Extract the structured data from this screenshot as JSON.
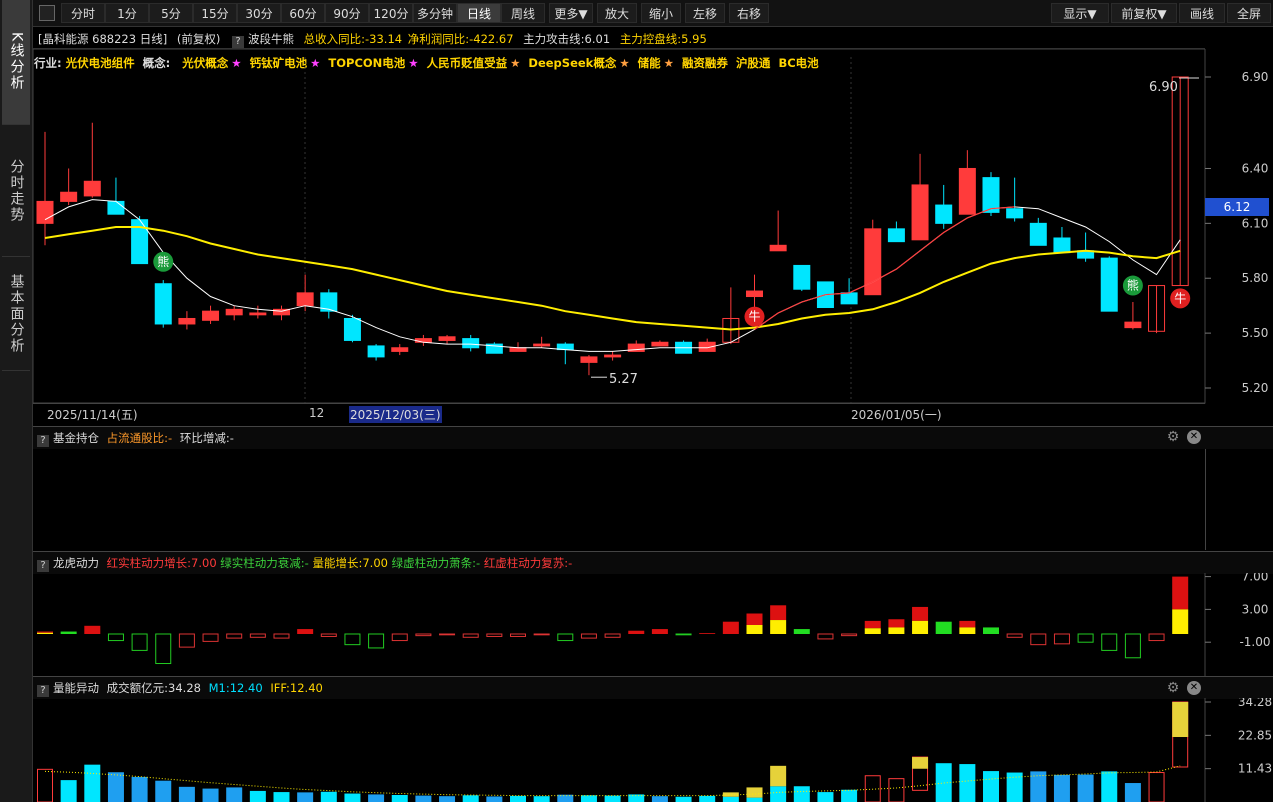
{
  "sidebar": {
    "tabs": [
      {
        "label": "K线分析",
        "active": true
      },
      {
        "label": "分时走势",
        "active": false
      },
      {
        "label": "基本面分析",
        "active": false
      }
    ]
  },
  "toolbar": {
    "periods": [
      "分时",
      "1分",
      "5分",
      "15分",
      "30分",
      "60分",
      "90分",
      "120分",
      "多分钟",
      "日线",
      "周线",
      "更多▼",
      "放大",
      "缩小",
      "左移",
      "右移"
    ],
    "active_period": "日线",
    "right_buttons": [
      "显示▼",
      "前复权▼",
      "画线",
      "全屏"
    ]
  },
  "info_bar": {
    "stock": "[晶科能源 688223 日线]",
    "adjust": "(前复权)",
    "indicator": "波段牛熊",
    "revenue": "总收入同比:-33.14",
    "profit": "净利润同比:-422.67",
    "attack": "主力攻击线:6.01",
    "control": "主力控盘线:5.95"
  },
  "concepts": {
    "industry_label": "行业:",
    "industry": "光伏电池组件",
    "concept_label": "概念:",
    "items": [
      {
        "name": "光伏概念",
        "star": "★",
        "star_color": "#ff40ff"
      },
      {
        "name": "钙钛矿电池",
        "star": "★",
        "star_color": "#ff40ff"
      },
      {
        "name": "TOPCON电池",
        "star": "★",
        "star_color": "#ff40ff"
      },
      {
        "name": "人民币贬值受益",
        "star": "★",
        "star_color": "#ffa040"
      },
      {
        "name": "DeepSeek概念",
        "star": "★",
        "star_color": "#ffa040"
      },
      {
        "name": "储能",
        "star": "★",
        "star_color": "#ffa040"
      },
      {
        "name": "融资融券",
        "star": "",
        "star_color": ""
      },
      {
        "name": "沪股通",
        "star": "",
        "star_color": ""
      },
      {
        "name": "BC电池",
        "star": "",
        "star_color": ""
      }
    ]
  },
  "main_chart": {
    "price_axis": [
      "6.90",
      "6.40",
      "6.10",
      "5.80",
      "5.50",
      "5.20"
    ],
    "current_price": "6.12",
    "high_label": "6.90",
    "low_label": "5.27",
    "dates": [
      {
        "label": "2025/11/14(五)",
        "highlight": false
      },
      {
        "label": "12",
        "highlight": false
      },
      {
        "label": "2025/12/03(三)",
        "highlight": true
      },
      {
        "label": "2026/01/05(一)",
        "highlight": false
      }
    ],
    "markers": [
      {
        "text": "熊",
        "color": "#1a9a3a"
      },
      {
        "text": "牛",
        "color": "#e02020"
      },
      {
        "text": "熊",
        "color": "#1a9a3a"
      },
      {
        "text": "牛",
        "color": "#e02020"
      }
    ]
  },
  "fund_panel": {
    "title": "基金持仓",
    "ratio": "占流通股比:-",
    "change": "环比增减:-"
  },
  "dragon_panel": {
    "title": "龙虎动力",
    "a": "红实柱动力增长:7.00",
    "b": "绿实柱动力衰减:-",
    "c": "量能增长:7.00",
    "d": "绿虚柱动力萧条:-",
    "e": "红虚柱动力复苏:-",
    "axis": [
      "7.00",
      "3.00",
      "-1.00"
    ]
  },
  "volume_panel": {
    "title": "量能异动",
    "amount": "成交额亿元:34.28",
    "m1": "M1:12.40",
    "iff": "IFF:12.40",
    "axis": [
      "34.28",
      "22.85",
      "11.43"
    ]
  },
  "chart_data": [
    {
      "type": "candlestick",
      "title": "晶科能源 688223 日线",
      "ylim": [
        5.2,
        6.9
      ],
      "candles": [
        [
          6.1,
          6.22,
          5.98,
          6.6
        ],
        [
          6.22,
          6.27,
          6.2,
          6.4
        ],
        [
          6.25,
          6.33,
          6.24,
          6.65
        ],
        [
          6.22,
          6.15,
          6.15,
          6.35
        ],
        [
          6.12,
          5.88,
          5.88,
          6.14
        ],
        [
          5.77,
          5.55,
          5.53,
          5.79
        ],
        [
          5.55,
          5.58,
          5.52,
          5.62
        ],
        [
          5.57,
          5.62,
          5.55,
          5.65
        ],
        [
          5.6,
          5.63,
          5.57,
          5.65
        ],
        [
          5.6,
          5.61,
          5.58,
          5.65
        ],
        [
          5.6,
          5.63,
          5.57,
          5.65
        ],
        [
          5.65,
          5.72,
          5.62,
          5.82
        ],
        [
          5.72,
          5.62,
          5.58,
          5.74
        ],
        [
          5.58,
          5.46,
          5.45,
          5.6
        ],
        [
          5.43,
          5.37,
          5.35,
          5.44
        ],
        [
          5.4,
          5.42,
          5.38,
          5.44
        ],
        [
          5.45,
          5.47,
          5.43,
          5.49
        ],
        [
          5.46,
          5.48,
          5.44,
          5.49
        ],
        [
          5.47,
          5.42,
          5.4,
          5.49
        ],
        [
          5.44,
          5.39,
          5.39,
          5.45
        ],
        [
          5.4,
          5.42,
          5.4,
          5.45
        ],
        [
          5.43,
          5.44,
          5.42,
          5.48
        ],
        [
          5.44,
          5.41,
          5.33,
          5.45
        ],
        [
          5.34,
          5.37,
          5.27,
          5.38
        ],
        [
          5.37,
          5.38,
          5.35,
          5.4
        ],
        [
          5.4,
          5.44,
          5.4,
          5.46
        ],
        [
          5.43,
          5.45,
          5.43,
          5.46
        ],
        [
          5.45,
          5.39,
          5.39,
          5.46
        ],
        [
          5.4,
          5.45,
          5.4,
          5.47
        ],
        [
          5.45,
          5.58,
          5.44,
          5.75
        ],
        [
          5.7,
          5.73,
          5.6,
          5.82
        ],
        [
          5.95,
          5.98,
          5.95,
          6.17
        ],
        [
          5.87,
          5.74,
          5.73,
          5.87
        ],
        [
          5.78,
          5.64,
          5.64,
          5.78
        ],
        [
          5.72,
          5.66,
          5.66,
          5.8
        ],
        [
          5.71,
          6.07,
          5.71,
          6.12
        ],
        [
          6.07,
          6.0,
          6.0,
          6.11
        ],
        [
          6.01,
          6.31,
          6.01,
          6.48
        ],
        [
          6.2,
          6.1,
          6.07,
          6.31
        ],
        [
          6.15,
          6.4,
          6.15,
          6.5
        ],
        [
          6.35,
          6.16,
          6.14,
          6.38
        ],
        [
          6.18,
          6.13,
          6.11,
          6.35
        ],
        [
          6.1,
          5.98,
          5.98,
          6.13
        ],
        [
          6.02,
          5.94,
          5.94,
          6.08
        ],
        [
          5.95,
          5.91,
          5.89,
          6.05
        ],
        [
          5.91,
          5.62,
          5.62,
          5.92
        ],
        [
          5.53,
          5.56,
          5.52,
          5.67
        ],
        [
          5.51,
          5.76,
          5.5,
          5.76
        ],
        [
          5.76,
          6.9,
          5.76,
          6.9
        ]
      ],
      "series": [
        {
          "name": "主力攻击线",
          "color": "#ffffff",
          "values": [
            6.12,
            6.19,
            6.23,
            6.22,
            6.12,
            5.94,
            5.8,
            5.7,
            5.65,
            5.63,
            5.62,
            5.65,
            5.63,
            5.59,
            5.53,
            5.48,
            5.45,
            5.44,
            5.44,
            5.43,
            5.42,
            5.42,
            5.41,
            5.4,
            5.4,
            5.41,
            5.42,
            5.42,
            5.42,
            5.45,
            5.52,
            5.61,
            5.67,
            5.71,
            5.72,
            5.78,
            5.85,
            5.95,
            6.05,
            6.13,
            6.18,
            6.19,
            6.18,
            6.13,
            6.08,
            6.0,
            5.9,
            5.82,
            6.01
          ]
        },
        {
          "name": "主力控盘线",
          "color": "#ffee00",
          "values": [
            6.02,
            6.04,
            6.06,
            6.08,
            6.08,
            6.06,
            6.03,
            5.99,
            5.96,
            5.93,
            5.91,
            5.89,
            5.87,
            5.85,
            5.82,
            5.79,
            5.76,
            5.73,
            5.71,
            5.69,
            5.67,
            5.65,
            5.62,
            5.6,
            5.58,
            5.56,
            5.55,
            5.54,
            5.53,
            5.52,
            5.53,
            5.55,
            5.58,
            5.6,
            5.61,
            5.63,
            5.67,
            5.72,
            5.78,
            5.83,
            5.88,
            5.91,
            5.93,
            5.94,
            5.95,
            5.94,
            5.92,
            5.91,
            5.95
          ]
        }
      ]
    },
    {
      "type": "bar",
      "title": "龙虎动力",
      "ylim": [
        -3.5,
        8
      ],
      "values": [
        0.3,
        0.3,
        1.0,
        -0.8,
        -2.0,
        -3.6,
        -1.6,
        -0.9,
        -0.5,
        -0.4,
        -0.5,
        0.6,
        -0.3,
        -1.3,
        -1.7,
        -0.8,
        -0.2,
        -0.1,
        -0.4,
        -0.3,
        -0.3,
        -0.1,
        -0.8,
        -0.5,
        -0.4,
        0.4,
        0.6,
        -0.1,
        0.1,
        1.5,
        2.5,
        3.5,
        0.6,
        -0.6,
        -0.2,
        1.6,
        1.8,
        3.3,
        1.5,
        1.6,
        0.8,
        -0.4,
        -1.3,
        -1.2,
        -1.0,
        -2.0,
        -2.9,
        -0.8,
        7.0
      ],
      "yellow_part": [
        0.15,
        0,
        0,
        0,
        0,
        0,
        0,
        0,
        0,
        0,
        0,
        0,
        0,
        0,
        0,
        0,
        0,
        0,
        0,
        0,
        0,
        0,
        0,
        0,
        0,
        0,
        0,
        0,
        0,
        0,
        1.1,
        1.7,
        0,
        0,
        0,
        0.7,
        0.8,
        1.6,
        0,
        0.8,
        0,
        0,
        0,
        0,
        0,
        0,
        0,
        0,
        3.0
      ],
      "green_part": [
        0,
        0.3,
        0,
        0,
        0,
        0,
        0,
        0,
        0,
        0,
        0,
        0,
        0,
        0,
        0,
        0,
        0,
        0,
        0,
        0,
        0,
        0,
        0,
        0,
        0,
        0,
        0,
        0,
        0,
        0,
        0,
        0,
        0.6,
        0,
        0,
        0,
        0,
        0,
        1.5,
        0,
        0.8,
        0,
        0,
        0,
        0,
        0,
        0,
        0,
        0
      ]
    },
    {
      "type": "bar",
      "title": "量能异动",
      "ylim": [
        0,
        34.28
      ],
      "values": [
        11.2,
        7.5,
        12.8,
        10.2,
        8.6,
        7.3,
        5.2,
        4.6,
        5.0,
        3.8,
        3.4,
        3.3,
        3.5,
        2.9,
        2.6,
        2.4,
        2.2,
        2.0,
        2.3,
        1.9,
        2.1,
        2.0,
        2.5,
        2.3,
        2.2,
        2.6,
        2.0,
        1.8,
        2.1,
        3.3,
        5.0,
        12.4,
        5.4,
        3.4,
        4.2,
        9.0,
        8.0,
        15.4,
        13.3,
        13.0,
        10.6,
        10.1,
        10.5,
        9.3,
        9.4,
        10.5,
        6.5,
        10.1,
        34.28
      ],
      "yellow_part": [
        0,
        0,
        0,
        0,
        0,
        0,
        0,
        0,
        0,
        0,
        0,
        0,
        0,
        0,
        0,
        0,
        0,
        0,
        0,
        0,
        0,
        0,
        0,
        0,
        0,
        0,
        0,
        0,
        0,
        1.5,
        3.5,
        7.0,
        0,
        0,
        0,
        0,
        0,
        4.0,
        0,
        0,
        0,
        0,
        0,
        0,
        0,
        0,
        0,
        0,
        12.0
      ],
      "hollow": [
        true,
        false,
        false,
        false,
        false,
        false,
        false,
        false,
        false,
        false,
        false,
        false,
        false,
        false,
        false,
        false,
        false,
        false,
        false,
        false,
        false,
        false,
        false,
        false,
        false,
        false,
        false,
        false,
        false,
        false,
        false,
        false,
        false,
        false,
        false,
        true,
        true,
        true,
        false,
        false,
        false,
        false,
        false,
        false,
        false,
        false,
        false,
        true,
        true
      ],
      "series": [
        {
          "name": "M1",
          "color": "#ffee00",
          "values": [
            10.5,
            10.2,
            9.8,
            9.3,
            8.7,
            8.0,
            7.3,
            6.6,
            6.0,
            5.4,
            4.8,
            4.3,
            3.9,
            3.5,
            3.2,
            2.9,
            2.7,
            2.5,
            2.4,
            2.3,
            2.2,
            2.2,
            2.2,
            2.2,
            2.2,
            2.2,
            2.2,
            2.2,
            2.2,
            2.4,
            2.7,
            3.3,
            3.6,
            3.8,
            4.0,
            4.4,
            4.8,
            5.6,
            6.5,
            7.2,
            7.9,
            8.5,
            9.0,
            9.3,
            9.6,
            10.0,
            10.1,
            10.3,
            12.4
          ]
        }
      ]
    }
  ]
}
